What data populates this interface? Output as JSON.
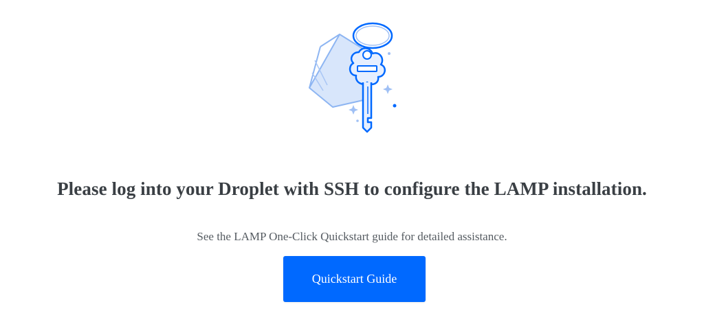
{
  "headline": "Please log into your Droplet with SSH to configure the LAMP installation.",
  "subtext": "See the LAMP One-Click Quickstart guide for detailed assistance.",
  "button": {
    "label": "Quickstart Guide",
    "color": "#0069ff"
  },
  "illustration": {
    "icon": "key-icon",
    "accent": "#0069ff",
    "tag_fill": "#d6e4fb"
  }
}
